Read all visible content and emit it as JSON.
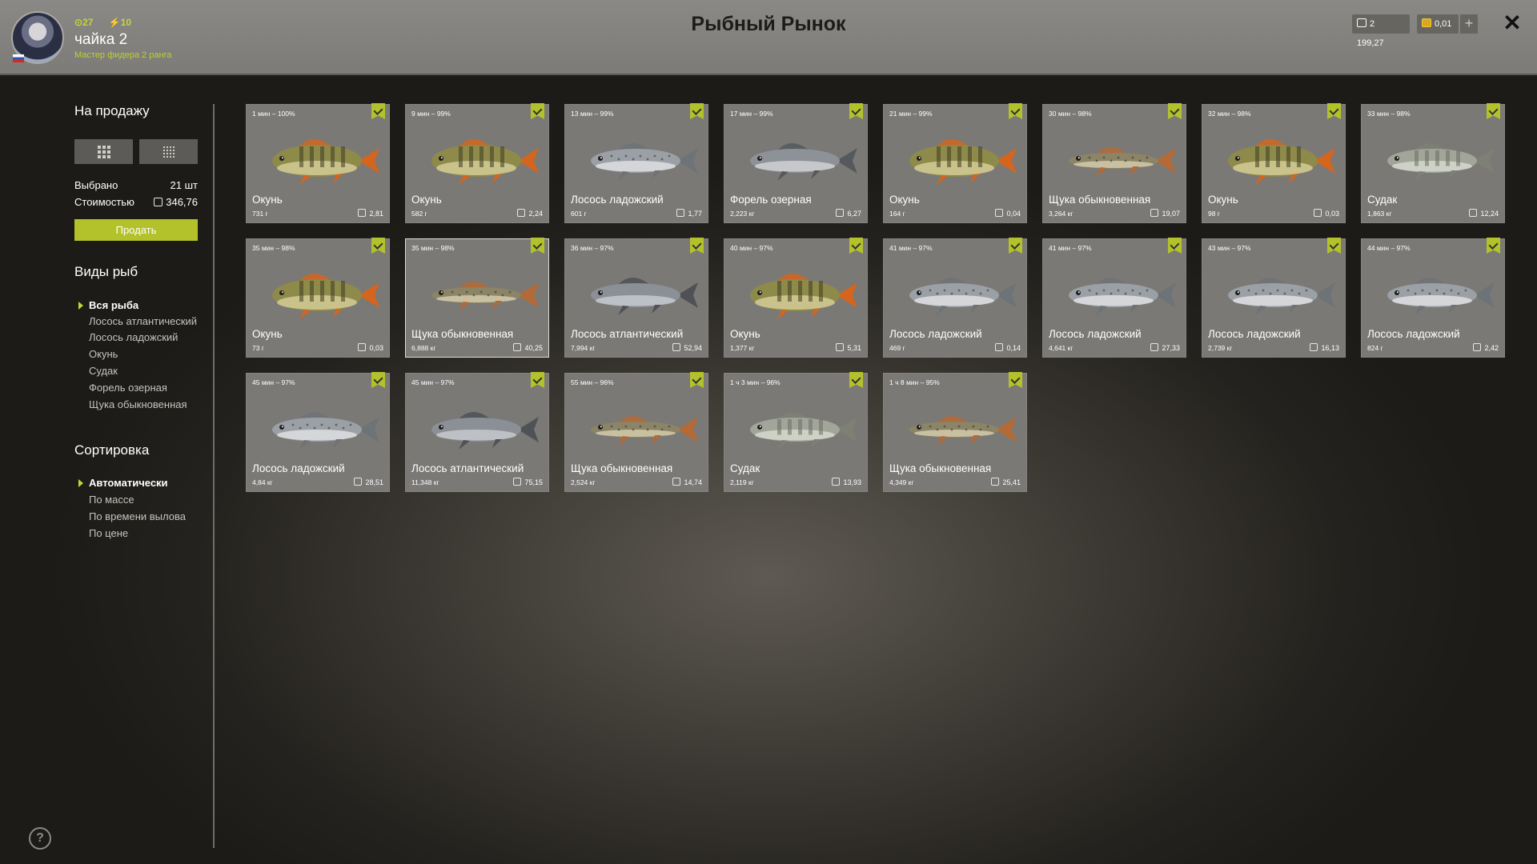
{
  "header": {
    "title": "Рыбный Рынок",
    "player": {
      "name": "чайка 2",
      "rank": "Мастер фидера 2 ранга",
      "level": "27",
      "stars": "10"
    },
    "balance_silver": "2 199,27",
    "balance_gold": "0,01",
    "add_label": "+",
    "close_label": "✕"
  },
  "sidebar": {
    "for_sale_heading": "На продажу",
    "selected_label": "Выбрано",
    "selected_value": "21 шт",
    "cost_label": "Стоимостью",
    "cost_value": "346,76",
    "sell_button": "Продать",
    "species_heading": "Виды рыб",
    "species": [
      "Вся рыба",
      "Лосось атлантический",
      "Лосось ладожский",
      "Окунь",
      "Судак",
      "Форель озерная",
      "Щука обыкновенная"
    ],
    "sort_heading": "Сортировка",
    "sort_options": [
      "Автоматически",
      "По массе",
      "По времени вылова",
      "По цене"
    ],
    "help_label": "?"
  },
  "colors": {
    "accent": "#b3c22a",
    "card_bg": "#7a7976",
    "header_bg": "#82817e"
  },
  "fish": [
    {
      "time": "1 мин – 100%",
      "name": "Окунь",
      "weight": "731 г",
      "price": "2,81",
      "kind": "perch"
    },
    {
      "time": "9 мин – 99%",
      "name": "Окунь",
      "weight": "582 г",
      "price": "2,24",
      "kind": "perch"
    },
    {
      "time": "13 мин – 99%",
      "name": "Лосось ладожский",
      "weight": "601 г",
      "price": "1,77",
      "kind": "salmon"
    },
    {
      "time": "17 мин – 99%",
      "name": "Форель озерная",
      "weight": "2,223 кг",
      "price": "6,27",
      "kind": "trout"
    },
    {
      "time": "21 мин – 99%",
      "name": "Окунь",
      "weight": "164 г",
      "price": "0,04",
      "kind": "perch"
    },
    {
      "time": "30 мин – 98%",
      "name": "Щука обыкновенная",
      "weight": "3,264 кг",
      "price": "19,07",
      "kind": "pike"
    },
    {
      "time": "32 мин – 98%",
      "name": "Окунь",
      "weight": "98 г",
      "price": "0,03",
      "kind": "perch"
    },
    {
      "time": "33 мин – 98%",
      "name": "Судак",
      "weight": "1,863 кг",
      "price": "12,24",
      "kind": "zander"
    },
    {
      "time": "35 мин – 98%",
      "name": "Окунь",
      "weight": "73 г",
      "price": "0,03",
      "kind": "perch"
    },
    {
      "time": "35 мин – 98%",
      "name": "Щука обыкновенная",
      "weight": "6,888 кг",
      "price": "40,25",
      "kind": "pike"
    },
    {
      "time": "36 мин – 97%",
      "name": "Лосось атлантический",
      "weight": "7,994 кг",
      "price": "52,94",
      "kind": "atlantic"
    },
    {
      "time": "40 мин – 97%",
      "name": "Окунь",
      "weight": "1,377 кг",
      "price": "5,31",
      "kind": "perch"
    },
    {
      "time": "41 мин – 97%",
      "name": "Лосось ладожский",
      "weight": "469 г",
      "price": "0,14",
      "kind": "salmon"
    },
    {
      "time": "41 мин – 97%",
      "name": "Лосось ладожский",
      "weight": "4,641 кг",
      "price": "27,33",
      "kind": "salmon"
    },
    {
      "time": "43 мин – 97%",
      "name": "Лосось ладожский",
      "weight": "2,739 кг",
      "price": "16,13",
      "kind": "salmon"
    },
    {
      "time": "44 мин – 97%",
      "name": "Лосось ладожский",
      "weight": "824 г",
      "price": "2,42",
      "kind": "salmon"
    },
    {
      "time": "45 мин – 97%",
      "name": "Лосось ладожский",
      "weight": "4,84 кг",
      "price": "28,51",
      "kind": "salmon"
    },
    {
      "time": "45 мин – 97%",
      "name": "Лосось атлантический",
      "weight": "11,348 кг",
      "price": "75,15",
      "kind": "atlantic"
    },
    {
      "time": "55 мин – 96%",
      "name": "Щука обыкновенная",
      "weight": "2,524 кг",
      "price": "14,74",
      "kind": "pike"
    },
    {
      "time": "1 ч 3 мин – 96%",
      "name": "Судак",
      "weight": "2,119 кг",
      "price": "13,93",
      "kind": "zander"
    },
    {
      "time": "1 ч 8 мин – 95%",
      "name": "Щука обыкновенная",
      "weight": "4,349 кг",
      "price": "25,41",
      "kind": "pike"
    }
  ]
}
